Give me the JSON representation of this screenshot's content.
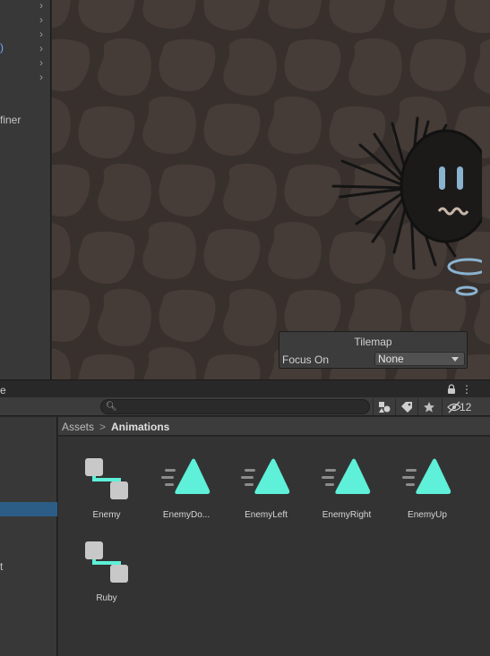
{
  "hierarchy": {
    "partial_labels": [
      ")",
      "finer",
      "t"
    ]
  },
  "scene_overlay": {
    "title": "Tilemap",
    "focus_label": "Focus On",
    "focus_value": "None"
  },
  "project_window": {
    "tab_partial": "e",
    "hidden_count": "12",
    "breadcrumb": [
      "Assets",
      "Animations"
    ],
    "breadcrumb_separator": ">",
    "assets": [
      {
        "name": "Enemy",
        "type": "animator-controller"
      },
      {
        "name": "EnemyDo...",
        "type": "animation-clip"
      },
      {
        "name": "EnemyLeft",
        "type": "animation-clip"
      },
      {
        "name": "EnemyRight",
        "type": "animation-clip"
      },
      {
        "name": "EnemyUp",
        "type": "animation-clip"
      },
      {
        "name": "Ruby",
        "type": "animator-controller"
      }
    ]
  },
  "colors": {
    "accent_cyan": "#5ef0d8",
    "selection_blue": "#2c5d87",
    "ground_dark": "#38302d",
    "ground_blob": "#463c38"
  }
}
